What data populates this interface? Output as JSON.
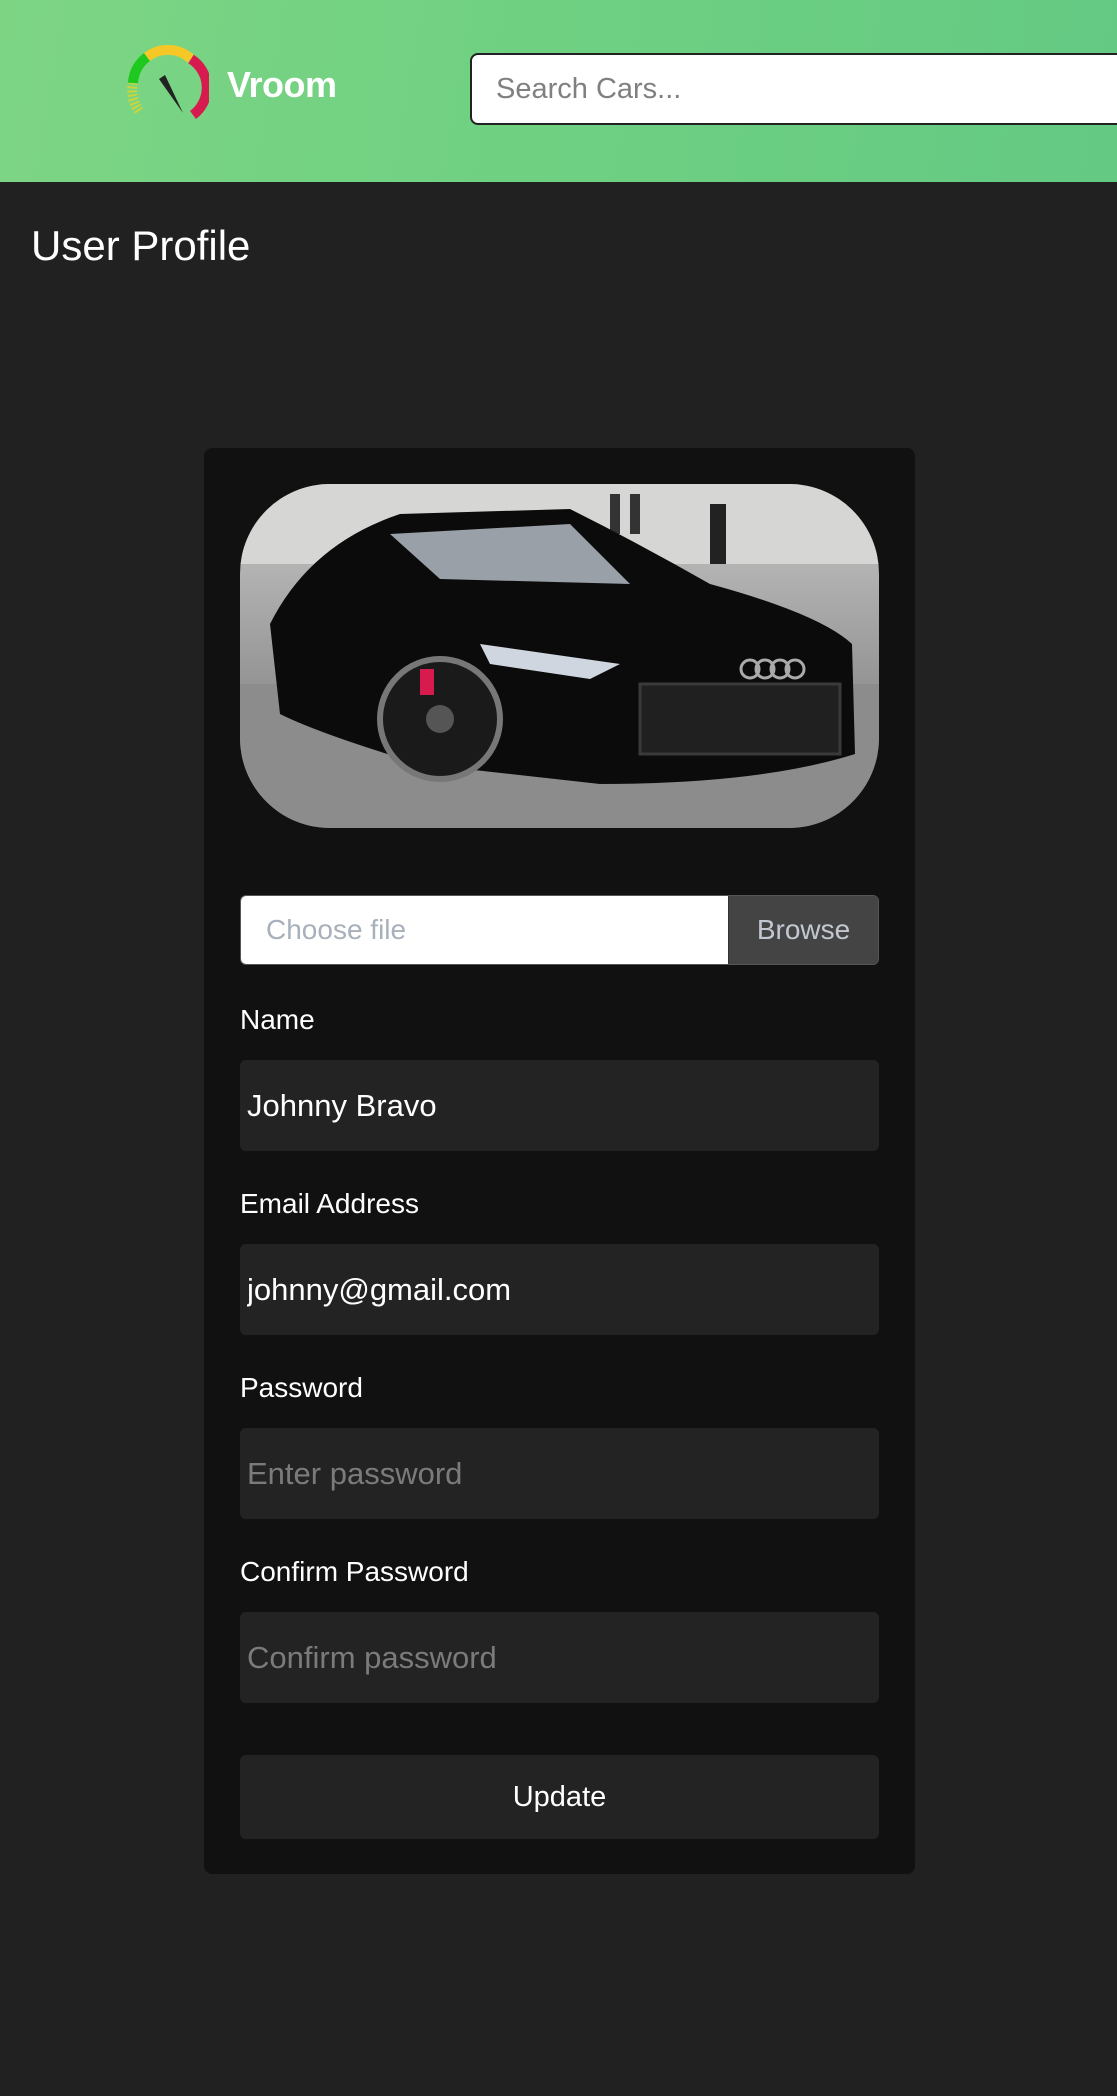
{
  "header": {
    "brand": "Vroom",
    "logo_icon": "speedometer-icon",
    "search_placeholder": "Search Cars...",
    "colors": {
      "gradient_start": "#7dd584",
      "gradient_end": "#64c983"
    }
  },
  "page": {
    "title": "User Profile"
  },
  "profile": {
    "image_alt": "black car photo",
    "file_input": {
      "placeholder": "Choose file",
      "button": "Browse"
    },
    "fields": [
      {
        "label": "Name",
        "value": "Johnny Bravo",
        "placeholder": ""
      },
      {
        "label": "Email Address",
        "value": "johnny@gmail.com",
        "placeholder": ""
      },
      {
        "label": "Password",
        "value": "",
        "placeholder": "Enter password"
      },
      {
        "label": "Confirm Password",
        "value": "",
        "placeholder": "Confirm password"
      }
    ],
    "submit": "Update"
  }
}
